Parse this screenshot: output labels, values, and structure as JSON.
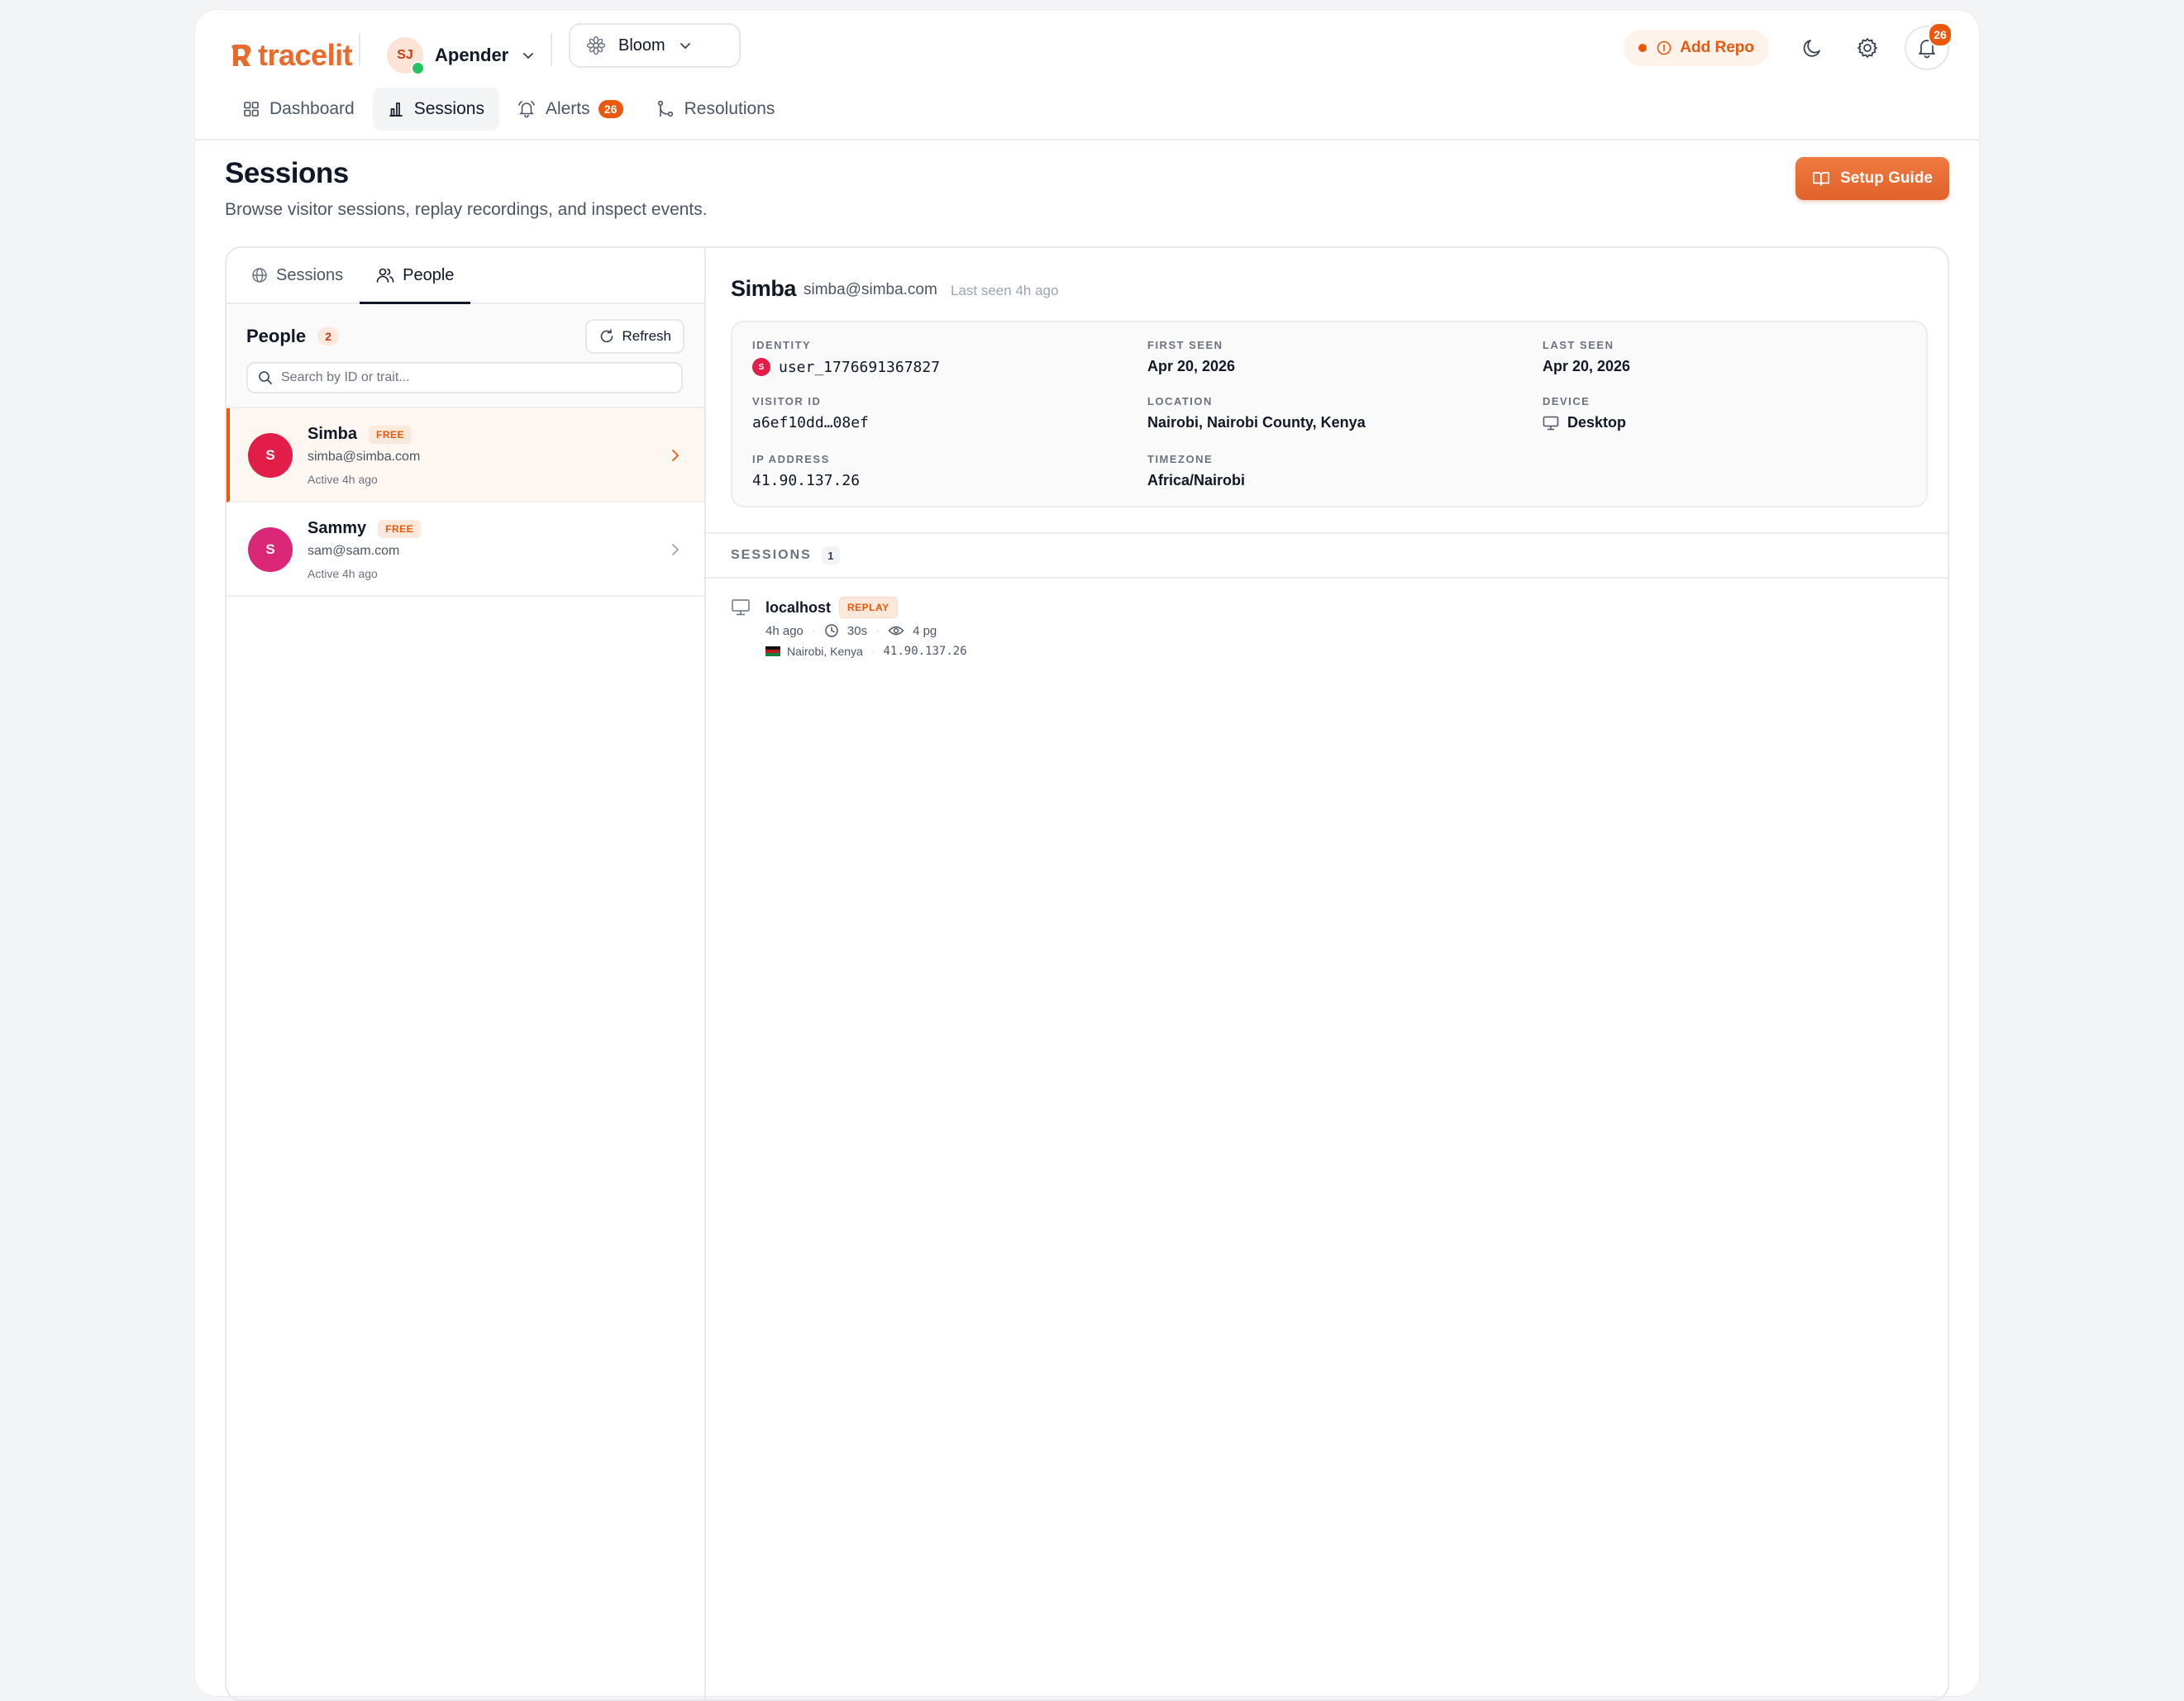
{
  "brand": {
    "name": "tracelit",
    "accent": "#ea580c"
  },
  "workspace": {
    "initials": "SJ",
    "name": "Apender"
  },
  "project": {
    "name": "Bloom"
  },
  "toolbar": {
    "add_repo_label": "Add Repo",
    "notifications_count": "26"
  },
  "nav": {
    "items": [
      {
        "label": "Dashboard"
      },
      {
        "label": "Sessions"
      },
      {
        "label": "Alerts",
        "badge": "26"
      },
      {
        "label": "Resolutions"
      }
    ],
    "active": "Sessions"
  },
  "page": {
    "title": "Sessions",
    "subtitle": "Browse visitor sessions, replay recordings, and inspect events.",
    "setup_button": "Setup Guide"
  },
  "left_tabs": [
    {
      "label": "Sessions"
    },
    {
      "label": "People"
    }
  ],
  "people_panel": {
    "title": "People",
    "count": "2",
    "refresh_label": "Refresh",
    "search_placeholder": "Search by ID or trait..."
  },
  "people": [
    {
      "initial": "S",
      "name": "Simba",
      "plan": "FREE",
      "email": "simba@simba.com",
      "active": "Active 4h ago",
      "avatar_color": "#e11d48",
      "selected": true
    },
    {
      "initial": "S",
      "name": "Sammy",
      "plan": "FREE",
      "email": "sam@sam.com",
      "active": "Active 4h ago",
      "avatar_color": "#db2777",
      "selected": false
    }
  ],
  "detail": {
    "name": "Simba",
    "email": "simba@simba.com",
    "last_seen": "Last seen 4h ago",
    "fields": {
      "identity": {
        "label": "IDENTITY",
        "value": "user_1776691367827",
        "badge": "S"
      },
      "first_seen": {
        "label": "FIRST SEEN",
        "value": "Apr 20, 2026"
      },
      "last_seen": {
        "label": "LAST SEEN",
        "value": "Apr 20, 2026"
      },
      "visitor_id": {
        "label": "VISITOR ID",
        "value": "a6ef10dd…08ef"
      },
      "location": {
        "label": "LOCATION",
        "value": "Nairobi, Nairobi County, Kenya"
      },
      "device": {
        "label": "DEVICE",
        "value": "Desktop"
      },
      "ip": {
        "label": "IP ADDRESS",
        "value": "41.90.137.26"
      },
      "timezone": {
        "label": "TIMEZONE",
        "value": "Africa/Nairobi"
      }
    },
    "sessions_label": "SESSIONS",
    "sessions_count": "1",
    "sessions": [
      {
        "host": "localhost",
        "tag": "REPLAY",
        "ago": "4h ago",
        "duration": "30s",
        "pages": "4 pg",
        "geo": "Nairobi, Kenya",
        "ip": "41.90.137.26"
      }
    ]
  }
}
